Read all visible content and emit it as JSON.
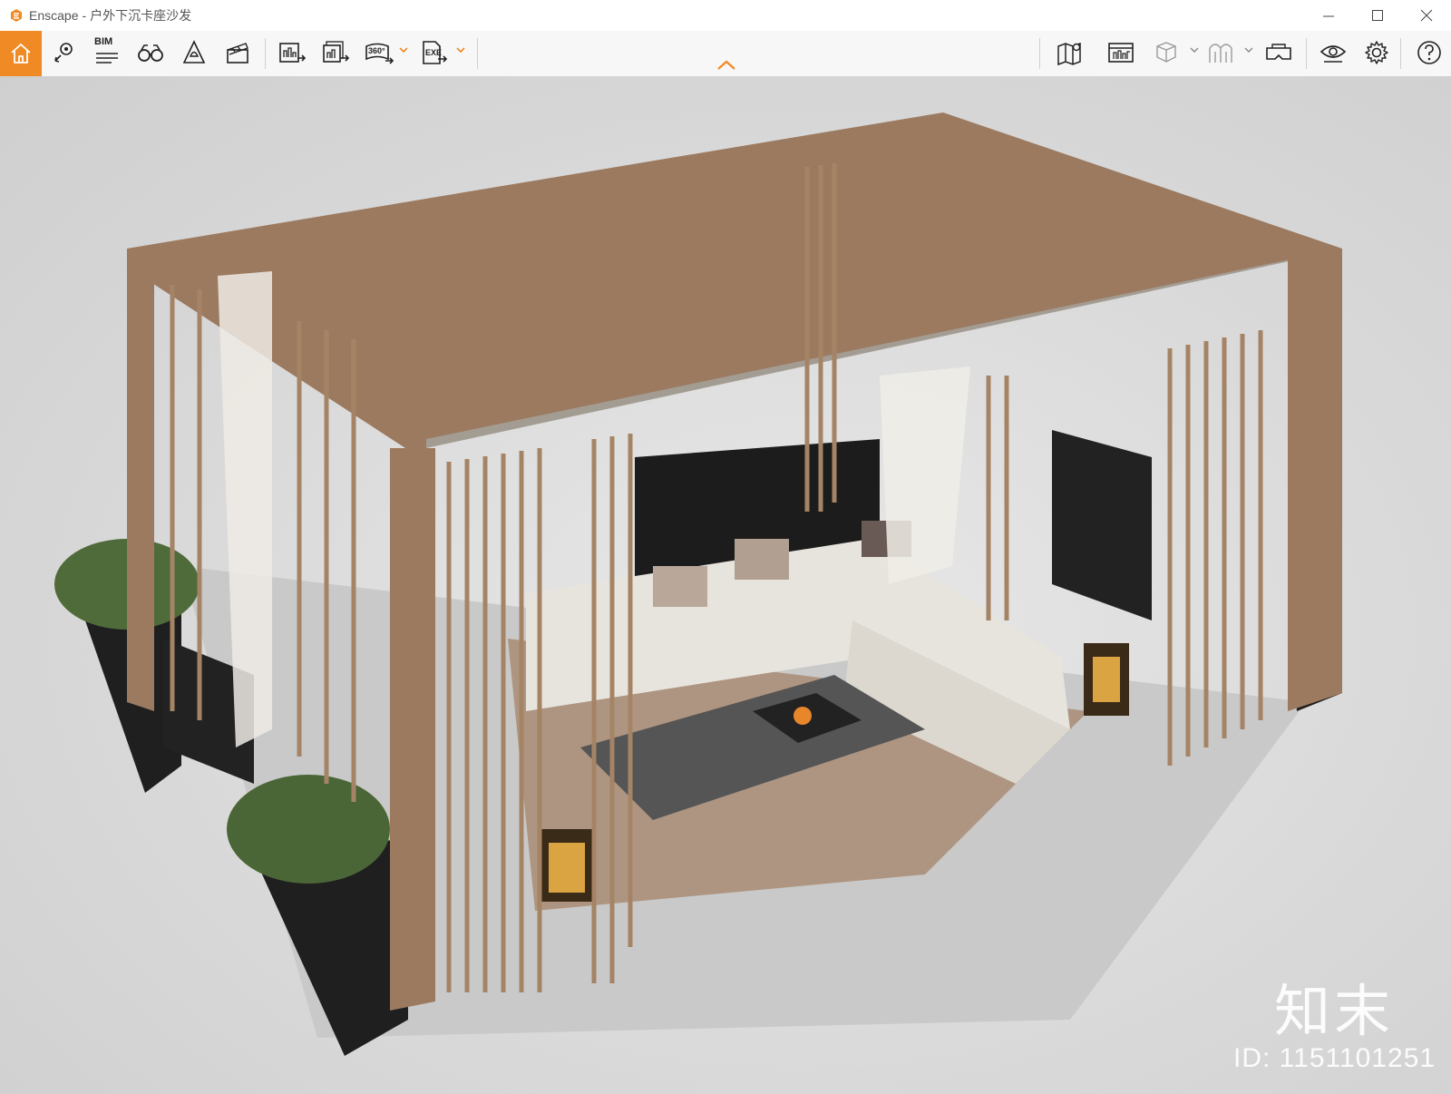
{
  "window": {
    "app_name": "Enscape",
    "separator": "-",
    "document_name": "户外下沉卡座沙发"
  },
  "toolbar": {
    "bim_label": "BIM",
    "export_360_label": "360°",
    "exe_label": "EXE",
    "accent_color": "#f08a24",
    "left_icons": [
      "home-icon",
      "location-pin-icon",
      "bim-icon",
      "binoculars-icon",
      "bell-icon",
      "clapperboard-icon"
    ],
    "export_icons": [
      "render-export-icon",
      "batch-render-icon",
      "panorama-360-icon",
      "exe-export-icon"
    ],
    "right_icons": [
      "map-icon",
      "asset-library-icon",
      "cube-view-icon",
      "visual-settings-icon",
      "vr-headset-icon",
      "eye-icon",
      "gear-icon",
      "help-icon"
    ]
  },
  "viewport": {
    "watermark_text": "知末",
    "watermark_id": "ID: 1151101251"
  }
}
